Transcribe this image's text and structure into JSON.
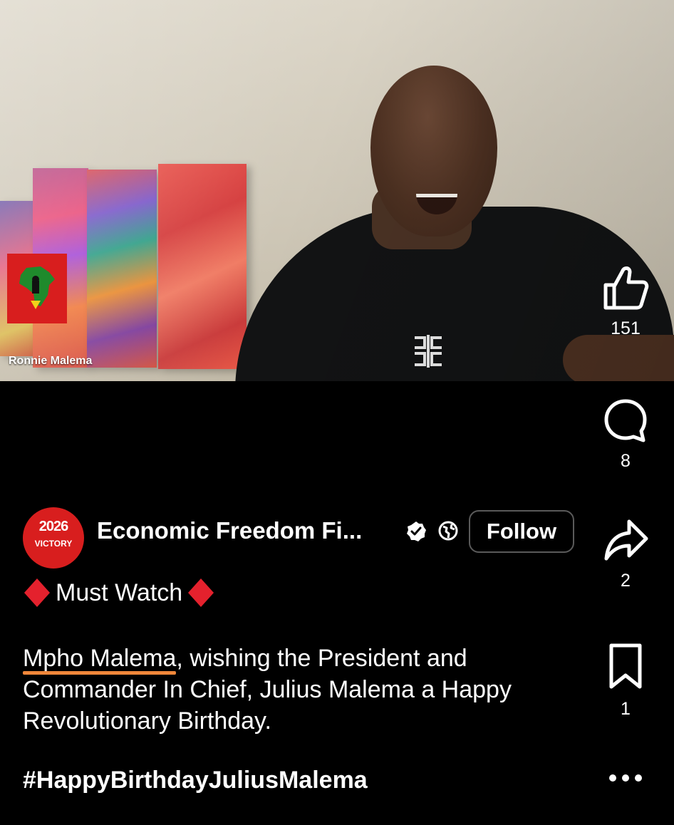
{
  "video": {
    "participant_name": "Ronnie Malema"
  },
  "actions": {
    "like_count": "151",
    "comment_count": "8",
    "share_count": "2",
    "save_count": "1"
  },
  "author": {
    "avatar_year": "2026",
    "avatar_tagline": "VICTORY",
    "name": "Economic Freedom Fi...",
    "follow_label": "Follow"
  },
  "post": {
    "headline": "Must Watch",
    "mention": "Mpho Malema",
    "description_rest": ", wishing the President and Commander In Chief, Julius Malema a Happy Revolutionary Birthday.",
    "hashtag": "#HappyBirthdayJuliusMalema"
  },
  "colors": {
    "background": "#000000",
    "mention_underline": "#f0873a",
    "diamond": "#e4212d",
    "brand_red": "#d81e1e"
  }
}
